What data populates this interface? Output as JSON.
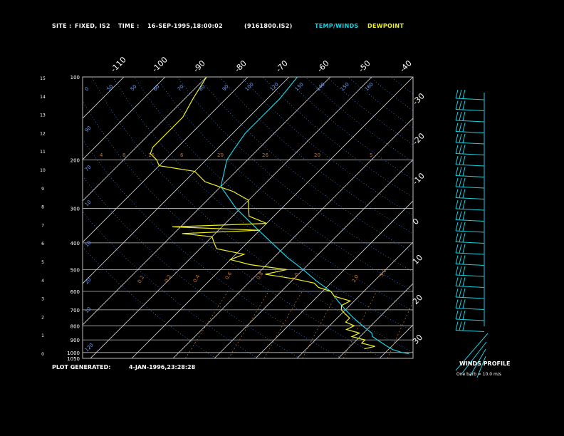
{
  "header": {
    "site_label": "SITE :",
    "site_value": "FIXED, IS2",
    "time_label": "TIME :",
    "time_value": "16-SEP-1995,18:00:02",
    "file_value": "(9161800.IS2)",
    "legend_temp": "TEMP/WINDS",
    "legend_dew": "DEWPOINT"
  },
  "footer": {
    "generated_label": "PLOT GENERATED:",
    "generated_value": "4-JAN-1996,23:28:28",
    "winds_title": "WINDS PROFILE",
    "winds_note": "One barb = 10.0 m/s"
  },
  "colors": {
    "temperature": "#19d0e0",
    "dewpoint": "#f0f020",
    "background": "#000000",
    "isotherm": "#d8d8d8",
    "mixing_ratio": "#c8732a",
    "dry_adiabat": "#4a7fd8"
  },
  "chart_data": {
    "type": "line",
    "subtype": "skew-T log-P",
    "pressure_ticks": [
      "100",
      "200",
      "300",
      "400",
      "500",
      "600",
      "700",
      "800",
      "900",
      "1000",
      "1050"
    ],
    "height_ticks": [
      "0",
      "1",
      "2",
      "3",
      "4",
      "5",
      "6",
      "7",
      "8",
      "9",
      "10",
      "11",
      "12",
      "13",
      "14",
      "15"
    ],
    "temp_ticks_top": [
      "-110",
      "-100",
      "-90",
      "-80",
      "-70",
      "-60",
      "-50",
      "-40"
    ],
    "temp_ticks_right": [
      "-30",
      "-20",
      "-10",
      "0",
      "10",
      "20",
      "30"
    ],
    "mixing_ratio_labels": [
      "4",
      "8",
      "16",
      "6",
      "20",
      "26",
      "20",
      "5"
    ],
    "adiabat_labels_top": [
      "0",
      "50",
      "50",
      "60",
      "70",
      "80",
      "90",
      "100",
      "120",
      "130",
      "140",
      "150",
      "160"
    ],
    "adiabat_labels_left": [
      "90",
      "70",
      "10",
      "10",
      "20",
      "10",
      "120",
      "130"
    ],
    "inner_labels": [
      "0.2",
      "0.2",
      "0.4",
      "0.6",
      "0.8",
      "1.0",
      "2.0",
      "5.0"
    ],
    "ylim_pressure": [
      1050,
      100
    ],
    "series": [
      {
        "name": "TEMP/WINDS",
        "pressure": [
          1010,
          1000,
          975,
          950,
          925,
          900,
          875,
          850,
          800,
          750,
          700,
          650,
          600,
          550,
          500,
          450,
          400,
          350,
          300,
          250,
          200,
          180,
          160,
          140,
          120,
          100
        ],
        "temperature": [
          26,
          24,
          21,
          19,
          17,
          15,
          13,
          12,
          8,
          4,
          0,
          -4,
          -8,
          -14,
          -20,
          -27,
          -34,
          -42,
          -51,
          -60,
          -65,
          -66,
          -67,
          -67,
          -67,
          -68
        ]
      },
      {
        "name": "DEWPOINT",
        "pressure": [
          970,
          950,
          925,
          900,
          875,
          850,
          825,
          800,
          775,
          750,
          725,
          700,
          675,
          650,
          625,
          600,
          580,
          560,
          540,
          520,
          500,
          480,
          460,
          440,
          420,
          400,
          380,
          370,
          360,
          350,
          340,
          320,
          300,
          280,
          260,
          240,
          220,
          210,
          200,
          190,
          180,
          160,
          140,
          120,
          100
        ],
        "temperature": [
          14,
          16,
          12,
          12,
          8,
          9,
          5,
          6,
          3,
          3,
          1,
          -1,
          -2,
          -1,
          -6,
          -8,
          -12,
          -14,
          -20,
          -28,
          -24,
          -34,
          -40,
          -38,
          -46,
          -48,
          -50,
          -58,
          -40,
          -62,
          -40,
          -46,
          -48,
          -50,
          -56,
          -65,
          -70,
          -80,
          -82,
          -85,
          -86,
          -86,
          -86,
          -88,
          -90
        ]
      }
    ]
  }
}
